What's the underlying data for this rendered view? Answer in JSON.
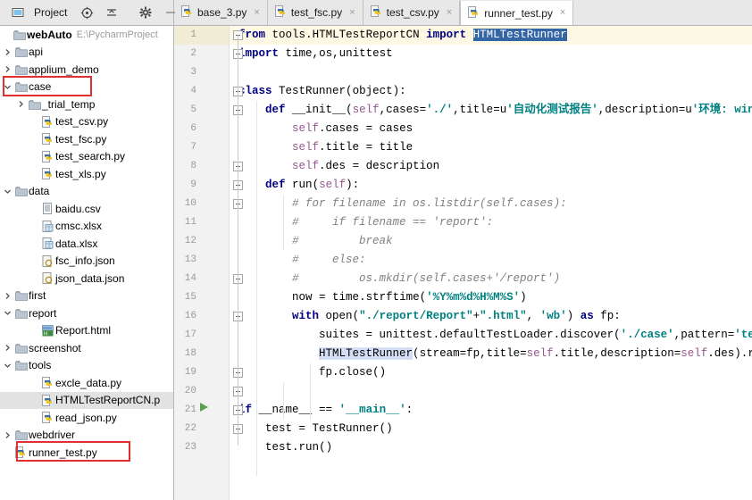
{
  "window": {
    "project_tool_label": "Project"
  },
  "project_toolbar": {
    "icons": [
      {
        "name": "project-view-icon",
        "glyph": "▣"
      },
      {
        "name": "locate-target-icon",
        "glyph": "⊕"
      },
      {
        "name": "collapse-all-icon",
        "glyph": "≑"
      },
      {
        "name": "settings-gear-icon",
        "glyph": "✿"
      },
      {
        "name": "hide-panel-icon",
        "glyph": "—"
      }
    ]
  },
  "tabs": [
    {
      "label": "base_3.py",
      "active": false,
      "close": "×"
    },
    {
      "label": "test_fsc.py",
      "active": false,
      "close": "×"
    },
    {
      "label": "test_csv.py",
      "active": false,
      "close": "×"
    },
    {
      "label": "runner_test.py",
      "active": true,
      "close": "×"
    }
  ],
  "sidebar": {
    "root": {
      "label": "webAuto",
      "path": "E:\\PycharmProject",
      "icon": "folder-icon"
    },
    "items": [
      {
        "label": "api",
        "icon": "folder-icon",
        "indent": 1,
        "twist": "collapsed",
        "selected": false
      },
      {
        "label": "applium_demo",
        "icon": "folder-icon",
        "indent": 1,
        "twist": "collapsed",
        "selected": false
      },
      {
        "label": "case",
        "icon": "folder-icon",
        "indent": 1,
        "twist": "expanded",
        "selected": false,
        "highlight": true
      },
      {
        "label": "_trial_temp",
        "icon": "folder-icon",
        "indent": 2,
        "twist": "collapsed",
        "selected": false
      },
      {
        "label": "test_csv.py",
        "icon": "python-file-icon",
        "indent": 3,
        "twist": "none",
        "selected": false
      },
      {
        "label": "test_fsc.py",
        "icon": "python-file-icon",
        "indent": 3,
        "twist": "none",
        "selected": false
      },
      {
        "label": "test_search.py",
        "icon": "python-file-icon",
        "indent": 3,
        "twist": "none",
        "selected": false
      },
      {
        "label": "test_xls.py",
        "icon": "python-file-icon",
        "indent": 3,
        "twist": "none",
        "selected": false
      },
      {
        "label": "data",
        "icon": "folder-icon",
        "indent": 1,
        "twist": "expanded",
        "selected": false
      },
      {
        "label": "baidu.csv",
        "icon": "csv-file-icon",
        "indent": 3,
        "twist": "none",
        "selected": false
      },
      {
        "label": "cmsc.xlsx",
        "icon": "xlsx-file-icon",
        "indent": 3,
        "twist": "none",
        "selected": false
      },
      {
        "label": "data.xlsx",
        "icon": "xlsx-file-icon",
        "indent": 3,
        "twist": "none",
        "selected": false
      },
      {
        "label": "fsc_info.json",
        "icon": "json-file-icon",
        "indent": 3,
        "twist": "none",
        "selected": false
      },
      {
        "label": "json_data.json",
        "icon": "json-file-icon",
        "indent": 3,
        "twist": "none",
        "selected": false
      },
      {
        "label": "first",
        "icon": "folder-icon",
        "indent": 1,
        "twist": "collapsed",
        "selected": false
      },
      {
        "label": "report",
        "icon": "folder-icon",
        "indent": 1,
        "twist": "expanded",
        "selected": false
      },
      {
        "label": "Report.html",
        "icon": "html-file-icon",
        "indent": 3,
        "twist": "none",
        "selected": false
      },
      {
        "label": "screenshot",
        "icon": "folder-icon",
        "indent": 1,
        "twist": "collapsed",
        "selected": false
      },
      {
        "label": "tools",
        "icon": "folder-icon",
        "indent": 1,
        "twist": "expanded",
        "selected": false
      },
      {
        "label": "excle_data.py",
        "icon": "python-file-icon",
        "indent": 3,
        "twist": "none",
        "selected": false
      },
      {
        "label": "HTMLTestReportCN.p",
        "icon": "python-file-icon",
        "indent": 3,
        "twist": "none",
        "selected": true
      },
      {
        "label": "read_json.py",
        "icon": "python-file-icon",
        "indent": 3,
        "twist": "none",
        "selected": false
      },
      {
        "label": "webdriver",
        "icon": "folder-icon",
        "indent": 1,
        "twist": "collapsed",
        "selected": false
      },
      {
        "label": "runner_test.py",
        "icon": "python-file-icon",
        "indent": 1,
        "twist": "none",
        "selected": false,
        "highlight": true
      }
    ]
  },
  "editor": {
    "current_line": 1,
    "run_marker_line": 21,
    "selection_text": "HTMLTestRunner",
    "line_numbers": [
      1,
      2,
      3,
      4,
      5,
      6,
      7,
      8,
      9,
      10,
      11,
      12,
      13,
      14,
      15,
      16,
      17,
      18,
      19,
      20,
      21,
      22,
      23
    ],
    "lines": [
      {
        "n": 1,
        "text": "from tools.HTMLTestReportCN import HTMLTestRunner"
      },
      {
        "n": 2,
        "text": "import time,os,unittest"
      },
      {
        "n": 3,
        "text": ""
      },
      {
        "n": 4,
        "text": "class TestRunner(object):"
      },
      {
        "n": 5,
        "text": "    def __init__(self,cases='./',title=u'自动化测试报告',description=u'环境: wind"
      },
      {
        "n": 6,
        "text": "        self.cases = cases"
      },
      {
        "n": 7,
        "text": "        self.title = title"
      },
      {
        "n": 8,
        "text": "        self.des = description"
      },
      {
        "n": 9,
        "text": "    def run(self):"
      },
      {
        "n": 10,
        "text": "        # for filename in os.listdir(self.cases):"
      },
      {
        "n": 11,
        "text": "        #     if filename == 'report':"
      },
      {
        "n": 12,
        "text": "        #         break"
      },
      {
        "n": 13,
        "text": "        #     else:"
      },
      {
        "n": 14,
        "text": "        #         os.mkdir(self.cases+'/report')"
      },
      {
        "n": 15,
        "text": "        now = time.strftime('%Y%m%d%H%M%S')"
      },
      {
        "n": 16,
        "text": "        with open(\"./report/Report\"+\".html\", 'wb') as fp:"
      },
      {
        "n": 17,
        "text": "            suites = unittest.defaultTestLoader.discover('./case',pattern='test*.py"
      },
      {
        "n": 18,
        "text": "            HTMLTestRunner(stream=fp,title=self.title,description=self.des).run(sui"
      },
      {
        "n": 19,
        "text": "            fp.close()"
      },
      {
        "n": 20,
        "text": ""
      },
      {
        "n": 21,
        "text": "if __name__ == '__main__':"
      },
      {
        "n": 22,
        "text": "    test = TestRunner()"
      },
      {
        "n": 23,
        "text": "    test.run()"
      }
    ]
  },
  "colors": {
    "keyword": "#000080",
    "string": "#008080",
    "comment": "#808080",
    "self_param": "#94558d",
    "selection_bg": "#3465a4",
    "current_line_bg": "#fdf8e3",
    "annotation_red": "#e03030",
    "sidebar_selected_bg": "#e2e2e2"
  }
}
